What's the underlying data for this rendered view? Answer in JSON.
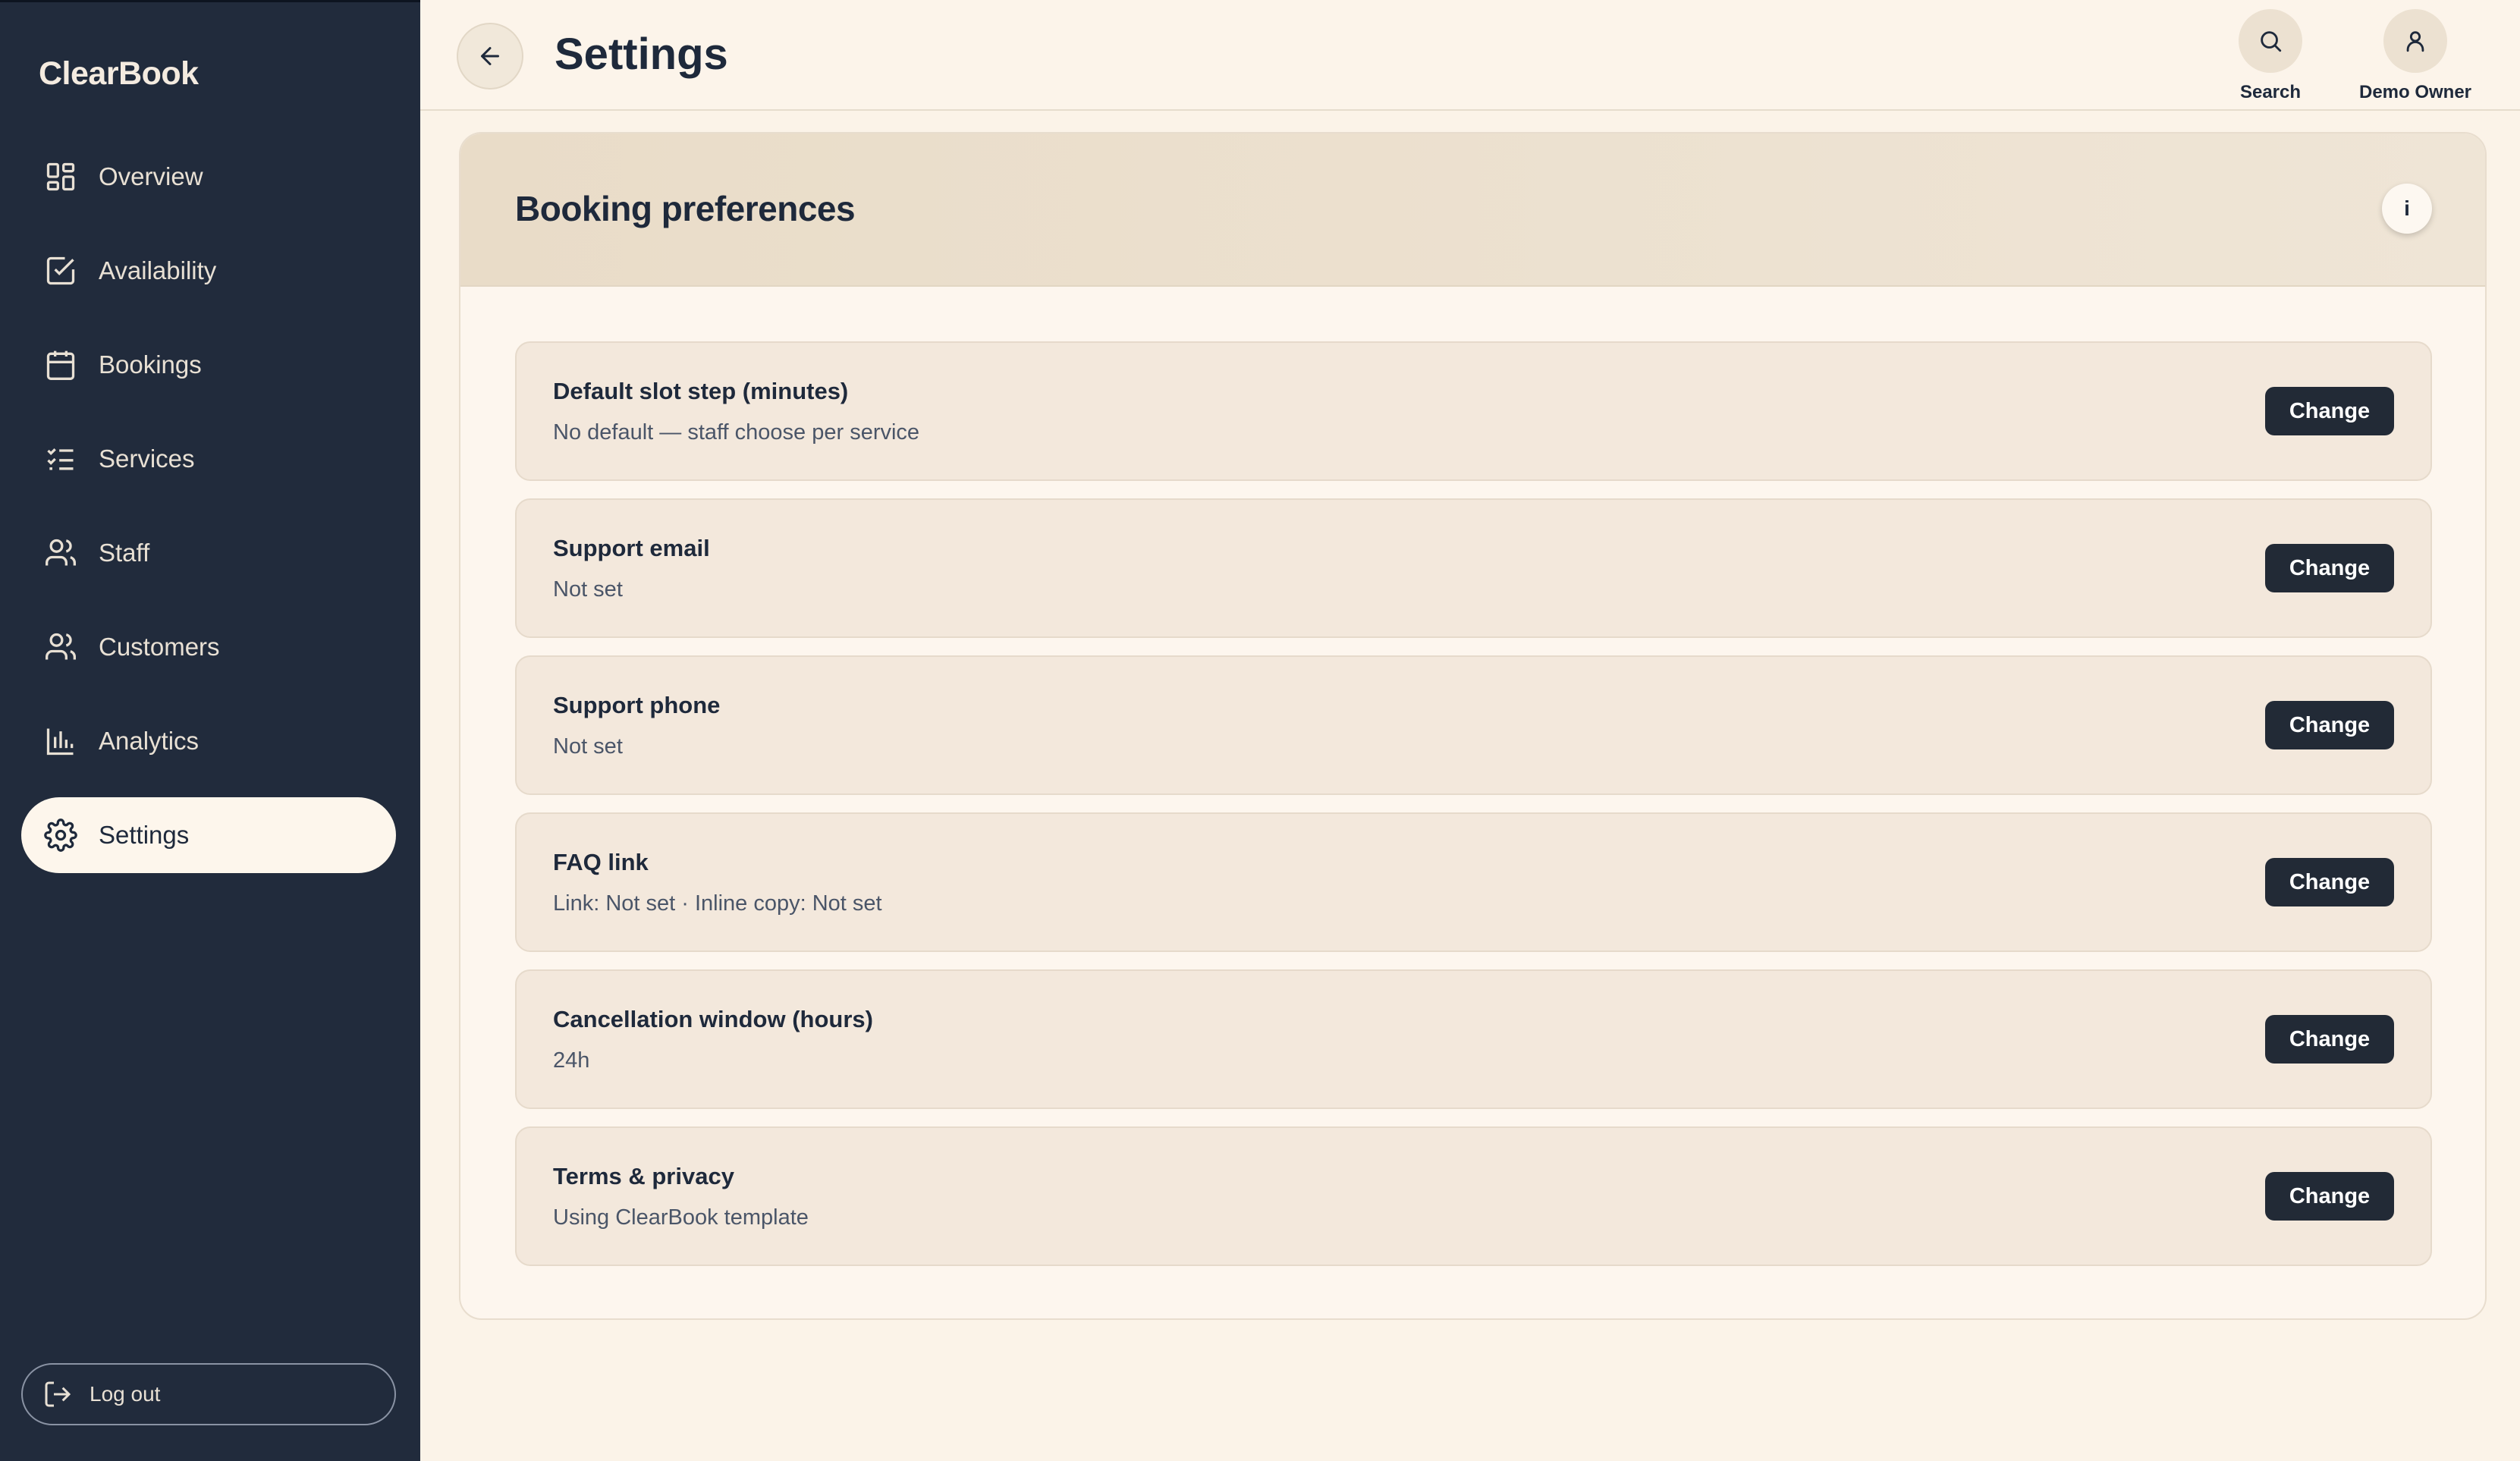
{
  "app": {
    "brand": "ClearBook"
  },
  "sidebar": {
    "items": [
      {
        "label": "Overview",
        "icon": "grid-icon"
      },
      {
        "label": "Availability",
        "icon": "checkbox-icon"
      },
      {
        "label": "Bookings",
        "icon": "calendar-icon"
      },
      {
        "label": "Services",
        "icon": "checklist-icon"
      },
      {
        "label": "Staff",
        "icon": "users-icon"
      },
      {
        "label": "Customers",
        "icon": "users-icon"
      },
      {
        "label": "Analytics",
        "icon": "bar-chart-icon"
      },
      {
        "label": "Settings",
        "icon": "gear-icon",
        "active": true
      }
    ],
    "logout_label": "Log out"
  },
  "header": {
    "title": "Settings",
    "search_label": "Search",
    "user_label": "Demo Owner"
  },
  "card": {
    "title": "Booking preferences",
    "info_label": "i",
    "rows": [
      {
        "label": "Default slot step (minutes)",
        "value": "No default — staff choose per service",
        "button": "Change"
      },
      {
        "label": "Support email",
        "value": "Not set",
        "button": "Change"
      },
      {
        "label": "Support phone",
        "value": "Not set",
        "button": "Change"
      },
      {
        "label": "FAQ link",
        "value": "Link: Not set · Inline copy: Not set",
        "button": "Change"
      },
      {
        "label": "Cancellation window (hours)",
        "value": "24h",
        "button": "Change"
      },
      {
        "label": "Terms & privacy",
        "value": "Using ClearBook template",
        "button": "Change"
      }
    ]
  },
  "colors": {
    "sidebar_bg": "#212b3c",
    "page_bg": "#fbf3e8",
    "button_dark": "#222a36"
  }
}
